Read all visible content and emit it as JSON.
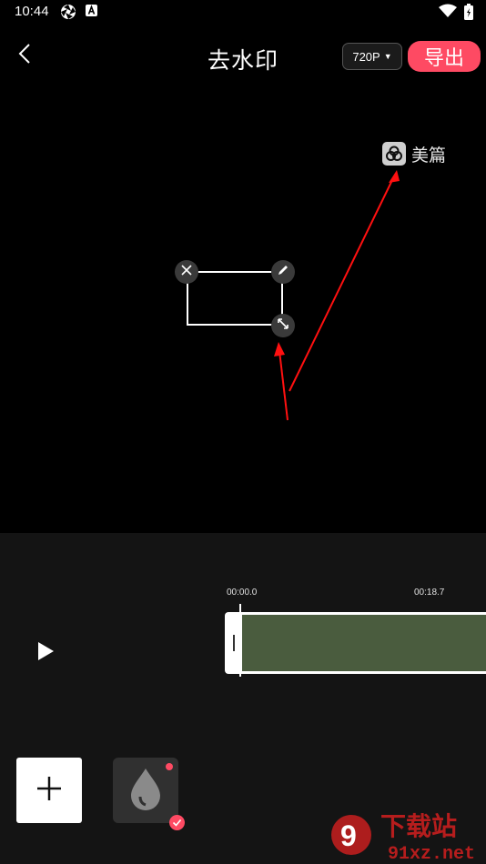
{
  "status_bar": {
    "time": "10:44"
  },
  "header": {
    "title": "去水印",
    "resolution": "720P",
    "export_label": "导出"
  },
  "preview": {
    "watermark_text": "美篇"
  },
  "timeline": {
    "start_time": "00:00.0",
    "end_time": "00:18.7"
  },
  "colors": {
    "accent": "#fe4a63",
    "track": "#4a5c3e",
    "panel": "#141414"
  },
  "icons": {
    "back": "chevron-left-icon",
    "close": "close-icon",
    "edit": "pencil-icon",
    "resize": "resize-icon",
    "play": "play-icon",
    "add": "plus-icon",
    "watermark_tool": "droplet-icon"
  },
  "site_badge": {
    "main": "下载站",
    "sub": "91xz.net"
  }
}
